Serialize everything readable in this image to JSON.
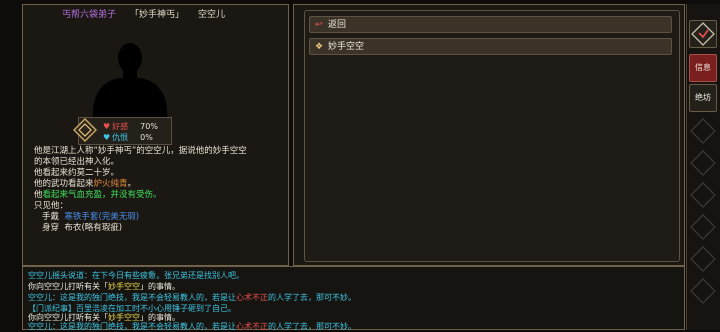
{
  "character": {
    "sect": "丐帮六袋弟子",
    "title": "「妙手神丐」",
    "name": "空空儿"
  },
  "stats": {
    "favor_label": "好感",
    "favor_value": "70%",
    "hatred_label": "仇恨",
    "hatred_value": "0%"
  },
  "description": {
    "line1": "他是江湖上人称“妙手神丐”的空空儿，据说他的妙手空空",
    "line2": "的本领已经出神入化。",
    "line3": "他看起来约莫二十岁。",
    "line4_a": "他的武功看起来",
    "line4_b": "炉火纯青",
    "line4_c": "。",
    "line5_a": "他",
    "line5_b": "看起来气血充盈，并没有受伤。",
    "line6": "只见他：",
    "equip1_slot": "手戴",
    "equip1_item": "寒铁手套",
    "equip1_qual": "(完美无瑕)",
    "equip2_slot": "身穿",
    "equip2_item": "布衣",
    "equip2_qual": "(略有瑕疵)"
  },
  "actions": {
    "back_label": "返回",
    "skill_label": "妙手空空"
  },
  "log": {
    "l1": "空空儿摇头说道：在下今日有些疲惫，张兄弟还是找别人吧。",
    "l2_a": "你向空空儿打听有关「",
    "l2_b": "妙手空空",
    "l2_c": "」的事情。",
    "l3_a": "空空儿：这是我的独门绝技，我是不会轻易教人的，若是让",
    "l3_b": "心术不正",
    "l3_c": "的人学了去，那可不妙。",
    "l4": "【门派纪事】百里浩凌在加工时不小心用锤子砸到了自己。",
    "l5_a": "你向空空儿打听有关「",
    "l5_b": "妙手空空",
    "l5_c": "」的事情。",
    "l6_a": "空空儿：这是我的独门绝技，我是不会轻易教人的，若是让",
    "l6_b": "心术不正",
    "l6_c": "的人学了去，那可不妙。"
  },
  "sidebar": {
    "info_label": "信息",
    "battle_label": "绝坊"
  },
  "colors": {
    "accent_red": "#7a1e1e",
    "sect_purple": "#b470e0",
    "log_cyan": "#3cc6e6"
  },
  "icons": {
    "back": "return-arrow-icon",
    "skill": "diamond-icon",
    "top_side": "diamond-menu-icon"
  }
}
